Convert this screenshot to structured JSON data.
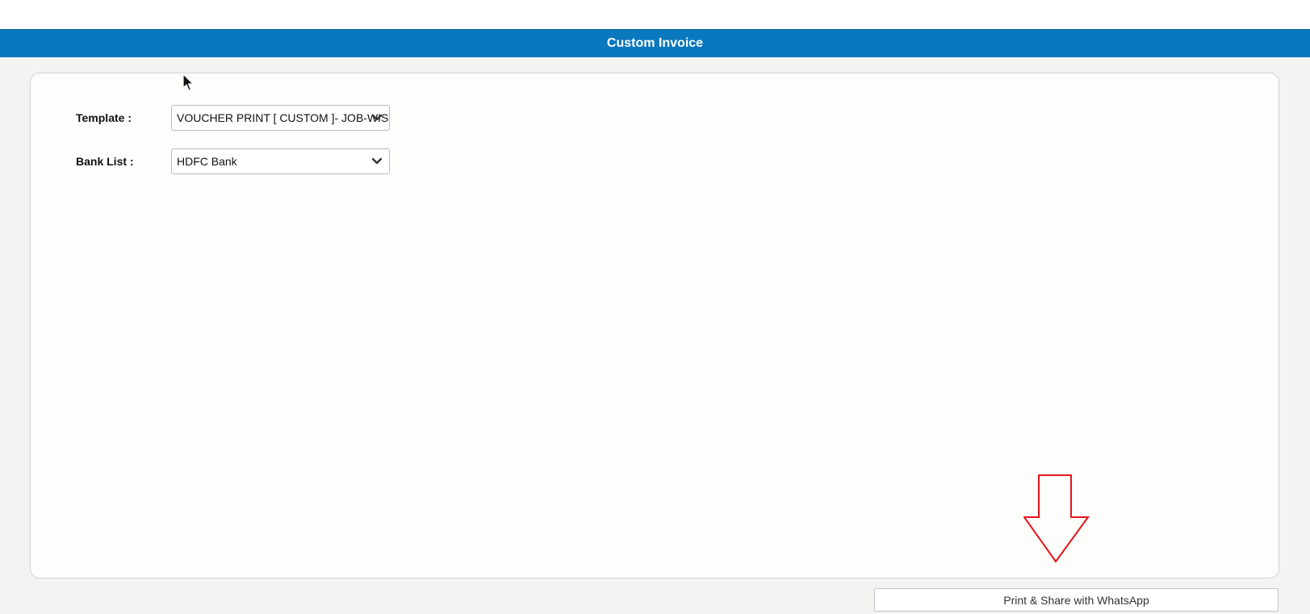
{
  "header": {
    "title": "Custom Invoice",
    "background_color": "#0a78be"
  },
  "form": {
    "template": {
      "label": "Template :",
      "selected_value": "VOUCHER PRINT [ CUSTOM ]- JOB-WISE"
    },
    "bank_list": {
      "label": "Bank List :",
      "selected_value": "HDFC Bank"
    }
  },
  "annotation": {
    "arrow_icon": "down-arrow-outline-icon",
    "color": "#e8141a"
  },
  "actions": {
    "print_share_label": "Print & Share with WhatsApp"
  },
  "icons": {
    "dropdown": "chevron-down-icon",
    "cursor": "mouse-pointer-icon"
  }
}
